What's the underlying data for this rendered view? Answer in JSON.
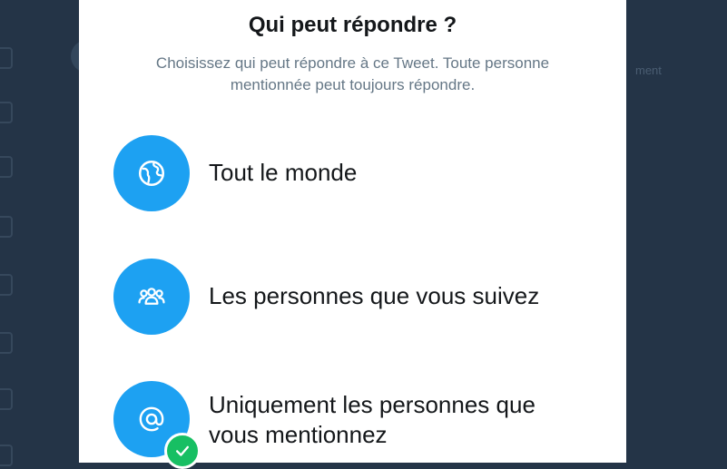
{
  "dialog": {
    "title": "Qui peut répondre ?",
    "subtitle": "Choisissez qui peut répondre à ce Tweet. Toute personne mentionnée peut toujours répondre."
  },
  "options": [
    {
      "label": "Tout le monde",
      "icon": "globe-icon",
      "selected": false
    },
    {
      "label": "Les personnes que vous suivez",
      "icon": "people-icon",
      "selected": false
    },
    {
      "label": "Uniquement les personnes que vous mentionnez",
      "icon": "at-icon",
      "selected": true
    }
  ],
  "background": {
    "partial_text": "ment"
  },
  "colors": {
    "accent": "#1da1f2",
    "selected_check": "#17bf63",
    "backdrop": "#243447"
  }
}
